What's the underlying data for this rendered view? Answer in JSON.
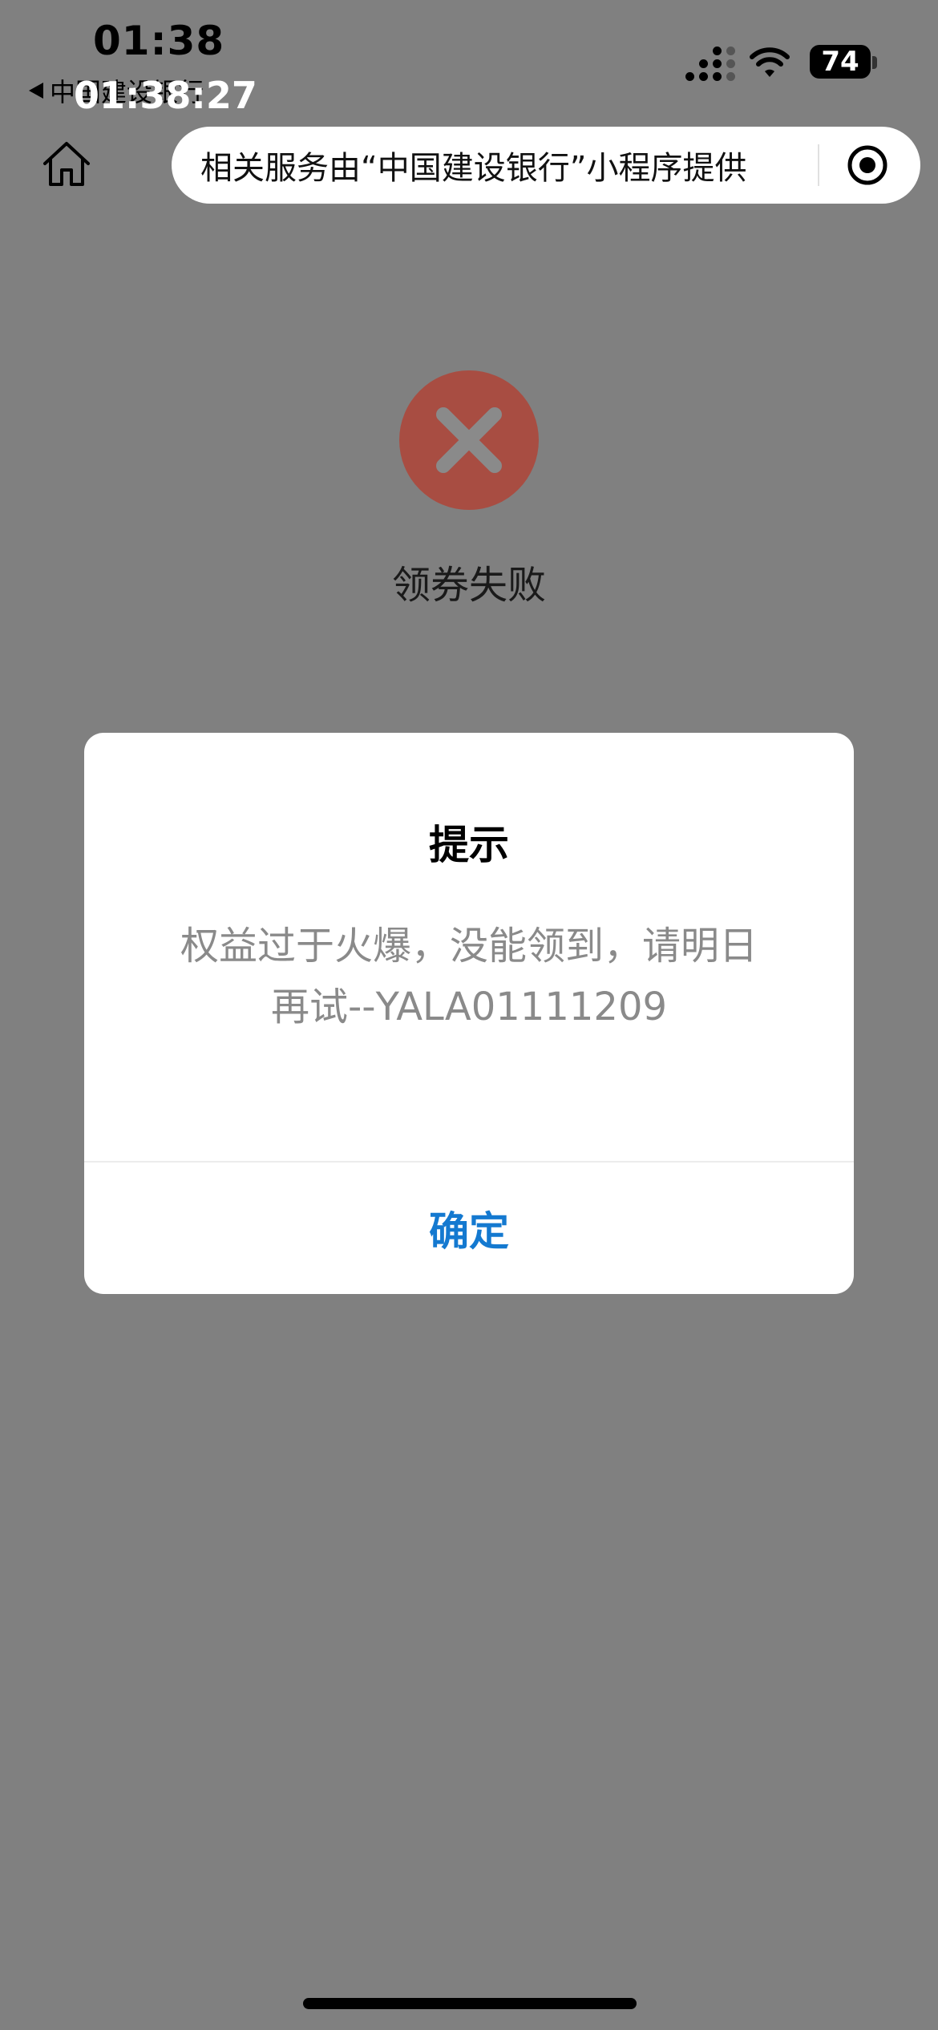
{
  "status_bar": {
    "time": "01:38",
    "back_app_label": "中国建设银行",
    "overlay_time": "01:38:27",
    "battery": "74"
  },
  "nav": {
    "capsule_text": "相关服务由“中国建设银行”小程序提供",
    "home_icon": "home-icon",
    "more_icon": "target-icon"
  },
  "result": {
    "icon": "close-icon",
    "title": "领券失败",
    "icon_color": "#a84d42"
  },
  "modal": {
    "title": "提示",
    "message_line1": "权益过于火爆，没能领到，请明日",
    "message_line2": "再试--YALA01111209",
    "confirm_label": "确定",
    "confirm_color": "#1479d0"
  }
}
